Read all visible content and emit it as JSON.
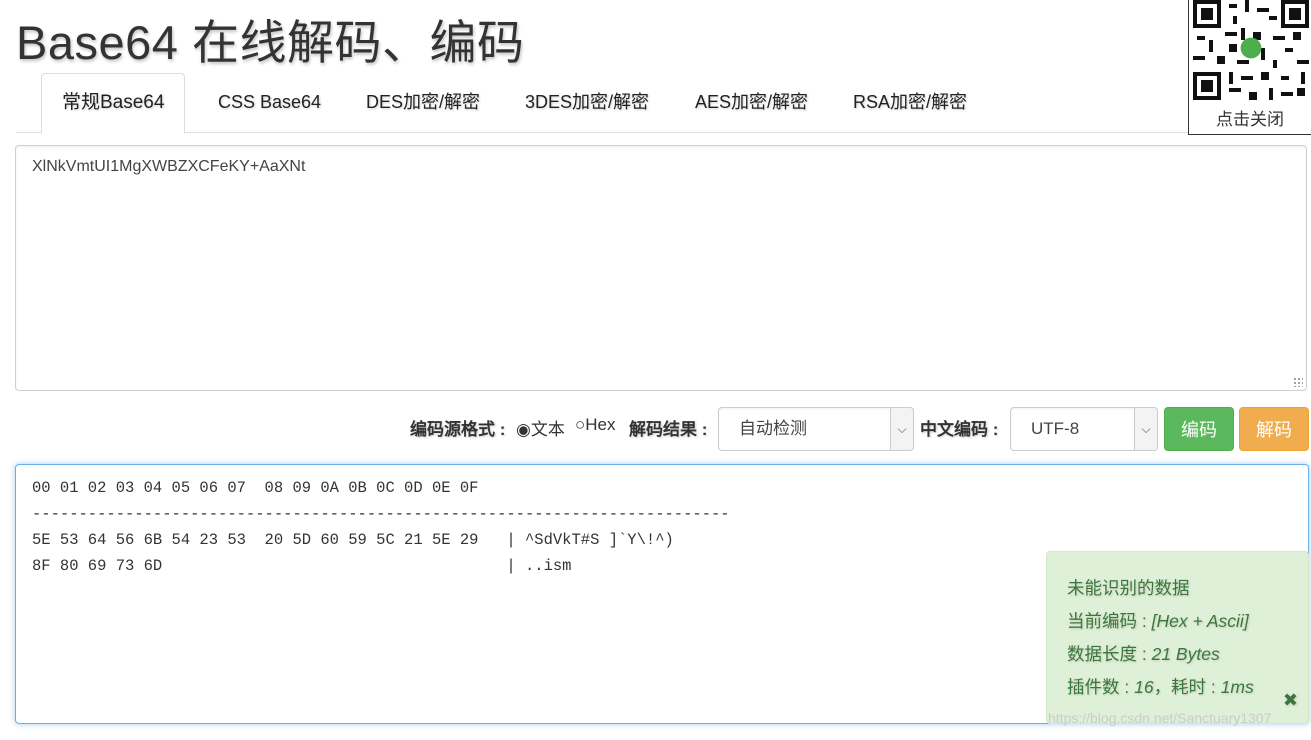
{
  "page_title": "Base64 在线解码、编码",
  "tabs": [
    {
      "label": "常规Base64",
      "active": true
    },
    {
      "label": "CSS Base64",
      "active": false
    },
    {
      "label": "DES加密/解密",
      "active": false
    },
    {
      "label": "3DES加密/解密",
      "active": false
    },
    {
      "label": "AES加密/解密",
      "active": false
    },
    {
      "label": "RSA加密/解密",
      "active": false
    }
  ],
  "qr": {
    "close_label": "点击关闭"
  },
  "input": {
    "value": "XlNkVmtUI1MgXWBZXCFeKY+AaXNt"
  },
  "controls": {
    "source_format_label": "编码源格式 :",
    "radio_text_label": "文本",
    "radio_hex_label": "Hex",
    "radio_text_checked": true,
    "decode_result_label": "解码结果 :",
    "decode_result_value": "自动检测",
    "chinese_encoding_label": "中文编码 :",
    "chinese_encoding_value": "UTF-8",
    "encode_button": "编码",
    "decode_button": "解码"
  },
  "output": {
    "lines": [
      "00 01 02 03 04 05 06 07  08 09 0A 0B 0C 0D 0E 0F",
      "---------------------------------------------------------------------------",
      "5E 53 64 56 6B 54 23 53  20 5D 60 59 5C 21 5E 29   | ^SdVkT#S ]`Y\\!^)",
      "8F 80 69 73 6D                                     | ..ism"
    ]
  },
  "info": {
    "title": "未能识别的数据",
    "encoding_label": "当前编码 : ",
    "encoding_value": "[Hex + Ascii]",
    "length_label": "数据长度 : ",
    "length_value": "21 Bytes",
    "plugins_label": "插件数 : ",
    "plugins_value": "16",
    "time_label": "，耗时 : ",
    "time_value": "1ms"
  },
  "watermark": "https://blog.csdn.net/Sanctuary1307",
  "colors": {
    "encode_button": "#5cb85c",
    "decode_button": "#f0ad4e",
    "info_panel_bg": "#dff0d8",
    "info_panel_text": "#3c763d",
    "output_border": "#66afe9"
  }
}
